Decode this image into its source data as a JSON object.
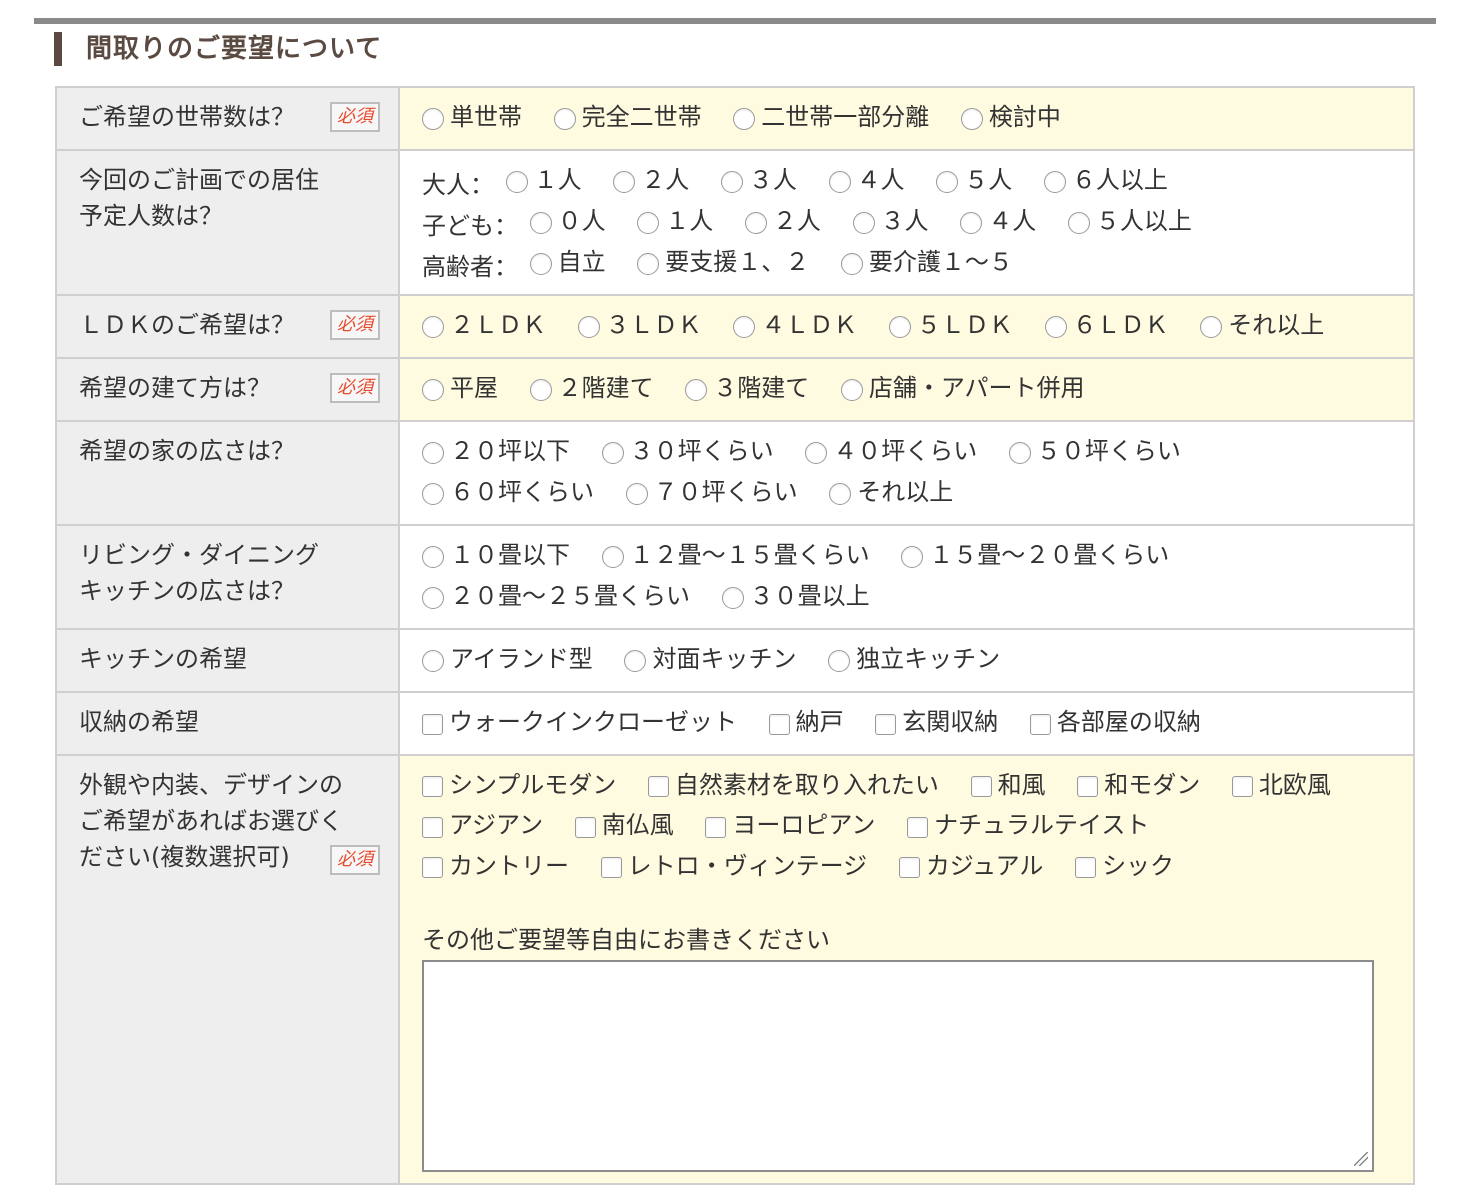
{
  "section_title": "間取りのご要望について",
  "required_label": "必須",
  "rows": {
    "household": {
      "label": "ご希望の世帯数は？",
      "options": [
        "単世帯",
        "完全二世帯",
        "二世帯一部分離",
        "検討中"
      ]
    },
    "residents": {
      "label_line1": "今回のご計画での居住",
      "label_line2": "予定人数は？",
      "adults": {
        "label": "大人：",
        "options": [
          "１人",
          "２人",
          "３人",
          "４人",
          "５人",
          "６人以上"
        ]
      },
      "children": {
        "label": "子ども：",
        "options": [
          "０人",
          "１人",
          "２人",
          "３人",
          "４人",
          "５人以上"
        ]
      },
      "elderly": {
        "label": "高齢者：",
        "options": [
          "自立",
          "要支援１、２",
          "要介護１〜５"
        ]
      }
    },
    "ldk": {
      "label": "ＬＤＫのご希望は？",
      "options": [
        "２ＬＤＫ",
        "３ＬＤＫ",
        "４ＬＤＫ",
        "５ＬＤＫ",
        "６ＬＤＫ",
        "それ以上"
      ]
    },
    "build_type": {
      "label": "希望の建て方は？",
      "options": [
        "平屋",
        "２階建て",
        "３階建て",
        "店舗・アパート併用"
      ]
    },
    "house_size": {
      "label": "希望の家の広さは？",
      "options_line1": [
        "２０坪以下",
        "３０坪くらい",
        "４０坪くらい",
        "５０坪くらい"
      ],
      "options_line2": [
        "６０坪くらい",
        "７０坪くらい",
        "それ以上"
      ]
    },
    "living_size": {
      "label_line1": "リビング・ダイニング",
      "label_line2": "キッチンの広さは？",
      "options_line1": [
        "１０畳以下",
        "１２畳〜１５畳くらい",
        "１５畳〜２０畳くらい"
      ],
      "options_line2": [
        "２０畳〜２５畳くらい",
        "３０畳以上"
      ]
    },
    "kitchen": {
      "label": "キッチンの希望",
      "options": [
        "アイランド型",
        "対面キッチン",
        "独立キッチン"
      ]
    },
    "storage": {
      "label": "収納の希望",
      "options": [
        "ウォークインクローゼット",
        "納戸",
        "玄関収納",
        "各部屋の収納"
      ]
    },
    "design": {
      "label_line1": "外観や内装、デザインの",
      "label_line2": "ご希望があればお選びく",
      "label_line3": "ださい(複数選択可)",
      "options_line1": [
        "シンプルモダン",
        "自然素材を取り入れたい",
        "和風",
        "和モダン",
        "北欧風"
      ],
      "options_line2": [
        "アジアン",
        "南仏風",
        "ヨーロピアン",
        "ナチュラルテイスト"
      ],
      "options_line3": [
        "カントリー",
        "レトロ・ヴィンテージ",
        "カジュアル",
        "シック"
      ],
      "note": "その他ご要望等自由にお書きください",
      "textarea_value": ""
    }
  }
}
